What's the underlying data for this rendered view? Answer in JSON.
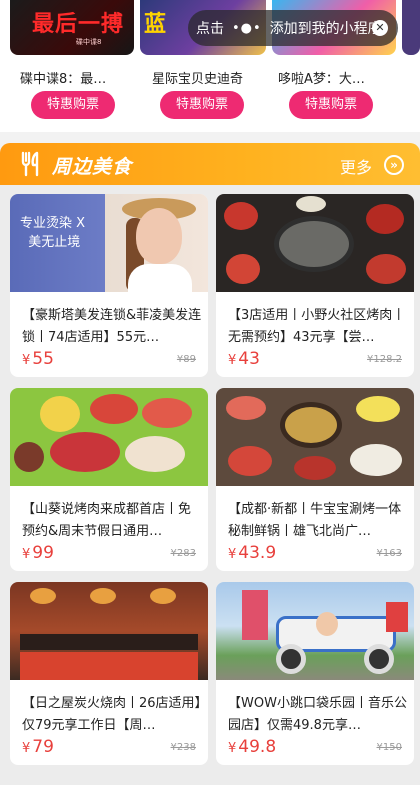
{
  "tickets": [
    {
      "title": "碟中谍8：最…",
      "button": "特惠购票",
      "banner_text": "最后一搏",
      "banner_sub": "碟中谍8"
    },
    {
      "title": "星际宝贝史迪奇",
      "button": "特惠购票",
      "banner_text": "蓝"
    },
    {
      "title": "哆啦A梦：大…",
      "button": "特惠购票"
    }
  ],
  "miniprogram_toast": {
    "text_before": "点击",
    "dots": "•●•",
    "text_after": "添加到我的小程序",
    "close_icon": "close-icon"
  },
  "section": {
    "title": "周边美食",
    "more_label": "更多",
    "more_icon": "arrow-right-circle-icon",
    "title_icon": "fork-knife-icon"
  },
  "deals": [
    {
      "title": "【豪斯塔美发连锁&菲凌美发连锁丨74店适用】55元…",
      "price": "55",
      "original": "¥89",
      "currency": "¥",
      "ad_line1": "专业烫染 X",
      "ad_line2": "美无止境"
    },
    {
      "title": "【3店适用丨小野火社区烤肉丨无需预约】43元享【尝…",
      "price": "43",
      "original": "¥128.2",
      "currency": "¥"
    },
    {
      "title": "【山葵说烤肉来成都首店丨免预约&周末节假日通用…",
      "price": "99",
      "original": "¥283",
      "currency": "¥"
    },
    {
      "title": "【成都·新都丨牛宝宝涮烤一体秘制鲜锅丨雄飞北尚广…",
      "price": "43.9",
      "original": "¥163",
      "currency": "¥"
    },
    {
      "title": "【日之屋炭火烧肉丨26店适用】仅79元享工作日【周…",
      "price": "79",
      "original": "¥238",
      "currency": "¥"
    },
    {
      "title": "【WOW小跳口袋乐园丨音乐公园店】仅需49.8元享…",
      "price": "49.8",
      "original": "¥150",
      "currency": "¥"
    }
  ],
  "colors": {
    "accent_pink": "#ee2a72",
    "section_orange": "#ffa514",
    "price_red": "#e8403c"
  }
}
